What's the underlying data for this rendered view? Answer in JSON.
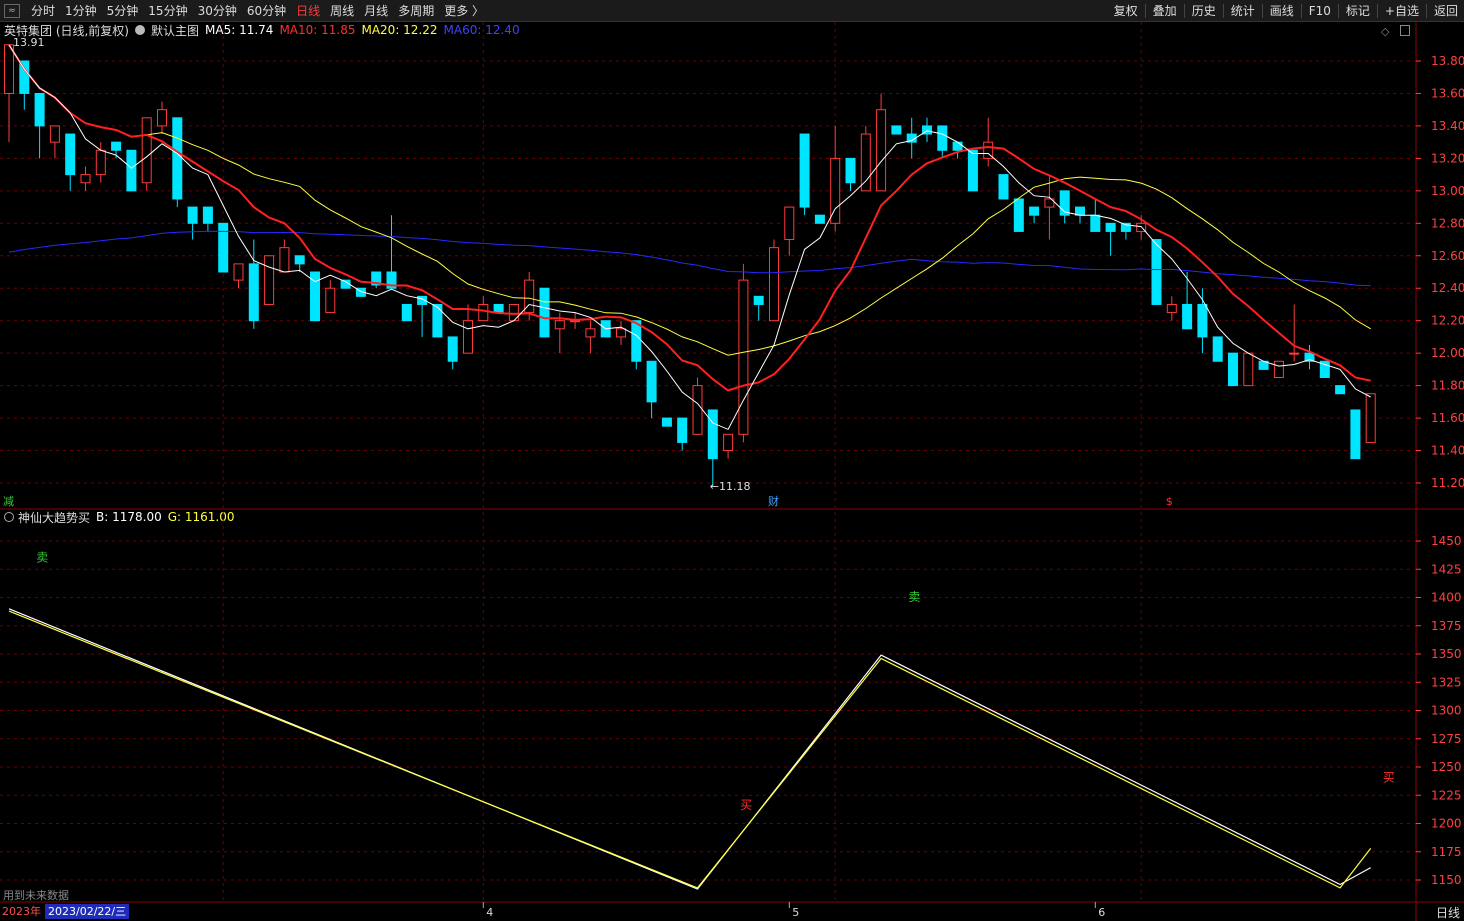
{
  "toolbar": {
    "periods": [
      "分时",
      "1分钟",
      "5分钟",
      "15分钟",
      "30分钟",
      "60分钟",
      "日线",
      "周线",
      "月线",
      "多周期",
      "更多 〉"
    ],
    "active_period": "日线",
    "right": [
      "复权",
      "叠加",
      "历史",
      "统计",
      "画线",
      "F10",
      "标记",
      "+自选",
      "返回"
    ]
  },
  "main_header": {
    "stock": "英特集团 (日线,前复权)",
    "template": "默认主图",
    "ma5": "MA5: 11.74",
    "ma10": "MA10: 11.85",
    "ma20": "MA20: 12.22",
    "ma60": "MA60: 12.40"
  },
  "sub_header": {
    "name": "神仙大趋势买",
    "b": "B: 1178.00",
    "g": "G: 1161.00"
  },
  "colors": {
    "up": "#ff3b3b",
    "down": "#00e5ff",
    "ma5": "#ffffff",
    "ma10": "#ff2020",
    "ma20": "#ffff40",
    "ma60": "#2828ff",
    "grid": "#6a0000",
    "axis": "#ff4040"
  },
  "chart_data": [
    {
      "type": "candlestick",
      "ylim": [
        11.1,
        13.9
      ],
      "yticks": [
        "13.80",
        "13.60",
        "13.40",
        "13.20",
        "13.00",
        "12.80",
        "12.60",
        "12.40",
        "12.20",
        "12.00",
        "11.80",
        "11.60",
        "11.40",
        "11.20"
      ],
      "x_labels": [
        "4",
        "5",
        "6"
      ],
      "high_label": "13.91",
      "low_label": "←11.18",
      "event_labels": [
        "减",
        "财",
        "$"
      ],
      "candles": [
        [
          13.6,
          13.9,
          13.3,
          13.9
        ],
        [
          13.8,
          13.8,
          13.5,
          13.6
        ],
        [
          13.6,
          13.6,
          13.2,
          13.4
        ],
        [
          13.3,
          13.4,
          13.2,
          13.4
        ],
        [
          13.35,
          13.35,
          13.0,
          13.1
        ],
        [
          13.05,
          13.15,
          13.0,
          13.1
        ],
        [
          13.1,
          13.3,
          13.05,
          13.25
        ],
        [
          13.3,
          13.3,
          13.2,
          13.25
        ],
        [
          13.25,
          13.25,
          13.0,
          13.0
        ],
        [
          13.05,
          13.45,
          13.0,
          13.45
        ],
        [
          13.4,
          13.55,
          13.35,
          13.5
        ],
        [
          13.45,
          13.45,
          12.9,
          12.95
        ],
        [
          12.9,
          12.9,
          12.7,
          12.8
        ],
        [
          12.9,
          12.9,
          12.75,
          12.8
        ],
        [
          12.8,
          12.8,
          12.5,
          12.5
        ],
        [
          12.45,
          12.55,
          12.4,
          12.55
        ],
        [
          12.55,
          12.7,
          12.15,
          12.2
        ],
        [
          12.3,
          12.6,
          12.3,
          12.6
        ],
        [
          12.5,
          12.7,
          12.5,
          12.65
        ],
        [
          12.6,
          12.6,
          12.5,
          12.55
        ],
        [
          12.5,
          12.5,
          12.2,
          12.2
        ],
        [
          12.25,
          12.45,
          12.25,
          12.4
        ],
        [
          12.45,
          12.45,
          12.4,
          12.4
        ],
        [
          12.4,
          12.4,
          12.35,
          12.35
        ],
        [
          12.5,
          12.5,
          12.4,
          12.42
        ],
        [
          12.5,
          12.85,
          12.4,
          12.4
        ],
        [
          12.3,
          12.3,
          12.2,
          12.2
        ],
        [
          12.35,
          12.35,
          12.1,
          12.3
        ],
        [
          12.3,
          12.3,
          12.1,
          12.1
        ],
        [
          12.1,
          12.1,
          11.9,
          11.95
        ],
        [
          12.0,
          12.3,
          12.0,
          12.2
        ],
        [
          12.2,
          12.35,
          12.2,
          12.3
        ],
        [
          12.3,
          12.3,
          12.25,
          12.25
        ],
        [
          12.2,
          12.3,
          12.2,
          12.3
        ],
        [
          12.25,
          12.5,
          12.2,
          12.45
        ],
        [
          12.4,
          12.4,
          12.1,
          12.1
        ],
        [
          12.15,
          12.25,
          12.0,
          12.2
        ],
        [
          12.2,
          12.25,
          12.15,
          12.2
        ],
        [
          12.1,
          12.2,
          12.0,
          12.15
        ],
        [
          12.2,
          12.2,
          12.1,
          12.1
        ],
        [
          12.1,
          12.2,
          12.05,
          12.15
        ],
        [
          12.2,
          12.2,
          11.9,
          11.95
        ],
        [
          11.95,
          11.95,
          11.6,
          11.7
        ],
        [
          11.6,
          11.6,
          11.55,
          11.55
        ],
        [
          11.6,
          11.6,
          11.4,
          11.45
        ],
        [
          11.5,
          11.85,
          11.5,
          11.8
        ],
        [
          11.65,
          11.65,
          11.18,
          11.35
        ],
        [
          11.4,
          11.5,
          11.35,
          11.5
        ],
        [
          11.5,
          12.55,
          11.45,
          12.45
        ],
        [
          12.35,
          12.35,
          12.2,
          12.3
        ],
        [
          12.2,
          12.7,
          12.2,
          12.65
        ],
        [
          12.7,
          12.9,
          12.6,
          12.9
        ],
        [
          13.35,
          13.35,
          12.85,
          12.9
        ],
        [
          12.85,
          12.85,
          12.8,
          12.8
        ],
        [
          12.8,
          13.4,
          12.75,
          13.2
        ],
        [
          13.2,
          13.2,
          13.0,
          13.05
        ],
        [
          13.0,
          13.4,
          13.0,
          13.35
        ],
        [
          13.0,
          13.6,
          13.0,
          13.5
        ],
        [
          13.4,
          13.4,
          13.35,
          13.35
        ],
        [
          13.35,
          13.45,
          13.2,
          13.3
        ],
        [
          13.4,
          13.45,
          13.3,
          13.35
        ],
        [
          13.4,
          13.4,
          13.2,
          13.25
        ],
        [
          13.3,
          13.3,
          13.2,
          13.25
        ],
        [
          13.25,
          13.25,
          13.0,
          13.0
        ],
        [
          13.2,
          13.45,
          13.15,
          13.3
        ],
        [
          13.1,
          13.1,
          12.95,
          12.95
        ],
        [
          12.95,
          12.95,
          12.75,
          12.75
        ],
        [
          12.9,
          12.9,
          12.8,
          12.85
        ],
        [
          12.9,
          13.1,
          12.7,
          12.95
        ],
        [
          13.0,
          13.0,
          12.8,
          12.85
        ],
        [
          12.9,
          12.9,
          12.8,
          12.85
        ],
        [
          12.85,
          12.95,
          12.75,
          12.75
        ],
        [
          12.8,
          12.8,
          12.6,
          12.75
        ],
        [
          12.8,
          12.8,
          12.7,
          12.75
        ],
        [
          12.75,
          12.85,
          12.7,
          12.8
        ],
        [
          12.7,
          12.7,
          12.3,
          12.3
        ],
        [
          12.25,
          12.35,
          12.2,
          12.3
        ],
        [
          12.3,
          12.5,
          12.15,
          12.15
        ],
        [
          12.3,
          12.4,
          12.0,
          12.1
        ],
        [
          12.1,
          12.1,
          11.95,
          11.95
        ],
        [
          12.0,
          12.0,
          11.8,
          11.8
        ],
        [
          11.8,
          12.0,
          11.85,
          12.0
        ],
        [
          11.95,
          11.95,
          11.9,
          11.9
        ],
        [
          11.85,
          11.95,
          11.85,
          11.95
        ],
        [
          12.0,
          12.3,
          11.95,
          12.0
        ],
        [
          12.0,
          12.05,
          11.9,
          11.95
        ],
        [
          11.95,
          11.95,
          11.85,
          11.85
        ],
        [
          11.8,
          11.8,
          11.75,
          11.75
        ],
        [
          11.65,
          11.65,
          11.35,
          11.35
        ],
        [
          11.45,
          11.75,
          11.45,
          11.75
        ]
      ]
    },
    {
      "type": "line",
      "ylim": [
        1137,
        1465
      ],
      "yticks": [
        "1450",
        "1425",
        "1400",
        "1375",
        "1350",
        "1325",
        "1300",
        "1275",
        "1250",
        "1225",
        "1200",
        "1175",
        "1150"
      ],
      "series": [
        {
          "name": "B",
          "points": [
            [
              0,
              1390
            ],
            [
              45,
              1142
            ],
            [
              57,
              1349
            ],
            [
              87,
              1146
            ],
            [
              89,
              1161
            ]
          ]
        },
        {
          "name": "G",
          "points": [
            [
              0,
              1388
            ],
            [
              45,
              1143
            ],
            [
              57,
              1346
            ],
            [
              87,
              1143
            ],
            [
              89,
              1178
            ]
          ]
        }
      ],
      "annotations": [
        {
          "text": "卖",
          "x": 1,
          "y": 1432,
          "color": "#30d030"
        },
        {
          "text": "卖",
          "x": 58,
          "y": 1397,
          "color": "#30d030"
        },
        {
          "text": "买",
          "x": 47,
          "y": 1213,
          "color": "#ff3030"
        },
        {
          "text": "买",
          "x": 89,
          "y": 1237,
          "color": "#ff3030"
        }
      ]
    }
  ],
  "footer": {
    "tip": "用到未来数据",
    "year": "2023年",
    "date": "2023/02/22/三",
    "period": "日线"
  }
}
